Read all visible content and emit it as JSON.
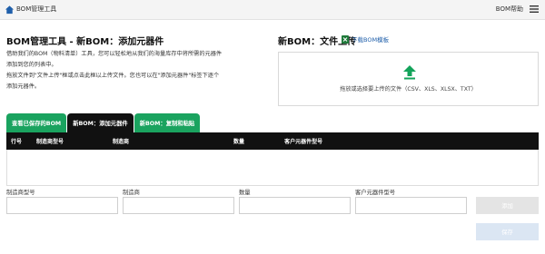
{
  "header": {
    "app_title": "BOM管理工具",
    "help_label": "BOM帮助",
    "home_icon": "home-icon",
    "menu_icon": "hamburger-menu-icon"
  },
  "intro": {
    "title": "BOM管理工具 - 新BOM：添加元器件",
    "line1": "借助我们的BOM（物料清单）工具，您可以轻松地从我们的海量库存中将所需的元器件",
    "line2": "添加到您的列表中。",
    "line3": "拖放文件到\"文件上传\"框或点击此框以上传文件。您也可以在\"添加元器件\"标签下逐个",
    "line4": "添加元器件。"
  },
  "upload": {
    "title": "新BOM：文件上传",
    "download_label": "下载BOM模板",
    "download_icon": "excel-file-icon",
    "upload_icon": "upload-arrow-icon",
    "hint": "拖放或选择要上传的文件（CSV、XLS、XLSX、TXT）"
  },
  "tabs": [
    {
      "label": "查看已保存的BOM"
    },
    {
      "label": "新BOM：添加元器件"
    },
    {
      "label": "新BOM：复制和粘贴"
    }
  ],
  "table": {
    "columns": [
      "行号",
      "制造商型号",
      "制造商",
      "数量",
      "客户元器件型号"
    ]
  },
  "form": {
    "labels": [
      "制造商型号",
      "制造商",
      "数量",
      "客户元器件型号"
    ],
    "values": [
      "",
      "",
      "",
      ""
    ],
    "add_label": "添加",
    "bottom_label": "保存"
  },
  "colors": {
    "tab_green": "#1aa35f",
    "tab_active": "#111111",
    "table_header": "#111111",
    "link_blue": "#1f5faa",
    "upload_green": "#13a35a"
  }
}
